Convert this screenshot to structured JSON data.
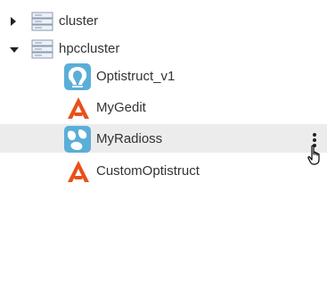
{
  "tree": {
    "clusters": [
      {
        "name": "cluster",
        "expanded": false,
        "icon": "server-rack-icon",
        "arrow_icon": "chevron-right-icon"
      },
      {
        "name": "hpccluster",
        "expanded": true,
        "icon": "server-rack-icon",
        "arrow_icon": "chevron-down-icon"
      }
    ],
    "apps": [
      {
        "name": "Optistruct_v1",
        "icon": "optistruct-app-icon"
      },
      {
        "name": "MyGedit",
        "icon": "altair-logo-icon"
      },
      {
        "name": "MyRadioss",
        "icon": "radioss-app-icon",
        "selected": true
      },
      {
        "name": "CustomOptistruct",
        "icon": "altair-logo-icon"
      }
    ],
    "row_actions_icon": "more-vertical-icon"
  },
  "colors": {
    "text": "#333333",
    "selected_row": "#ececec",
    "altair_orange": "#e8501a",
    "app_blue": "#5aaed8",
    "server_icon": "#8a9bb3"
  }
}
